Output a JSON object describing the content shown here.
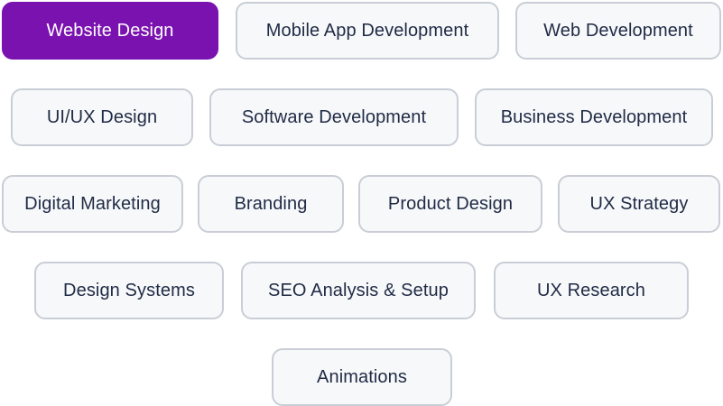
{
  "colors": {
    "accent": "#7a12b0",
    "chip_background": "#f7f8fa",
    "chip_border": "#c9ced6",
    "chip_text": "#1f2a44",
    "active_text": "#ffffff"
  },
  "tags": [
    {
      "label": "Website Design",
      "selected": true
    },
    {
      "label": "Mobile App Development",
      "selected": false
    },
    {
      "label": "Web Development",
      "selected": false
    },
    {
      "label": "UI/UX Design",
      "selected": false
    },
    {
      "label": "Software Development",
      "selected": false
    },
    {
      "label": "Business Development",
      "selected": false
    },
    {
      "label": "Digital Marketing",
      "selected": false
    },
    {
      "label": "Branding",
      "selected": false
    },
    {
      "label": "Product Design",
      "selected": false
    },
    {
      "label": "UX Strategy",
      "selected": false
    },
    {
      "label": "Design Systems",
      "selected": false
    },
    {
      "label": "SEO Analysis & Setup",
      "selected": false
    },
    {
      "label": "UX Research",
      "selected": false
    },
    {
      "label": "Animations",
      "selected": false
    }
  ]
}
